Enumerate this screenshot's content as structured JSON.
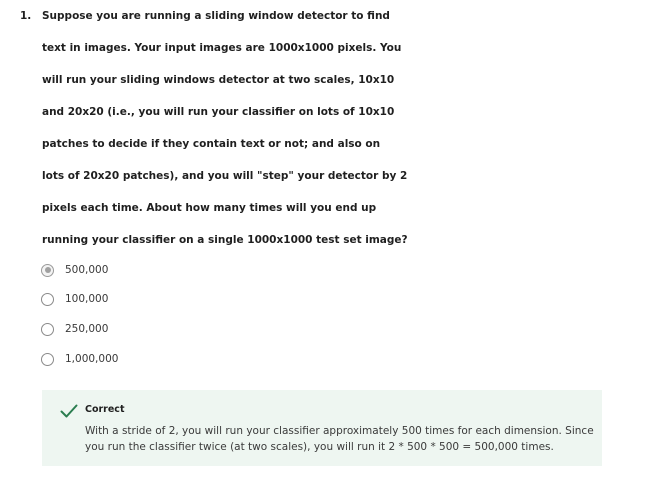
{
  "question": {
    "number": "1.",
    "lines": [
      "Suppose you are running a sliding window detector to find",
      "text in images. Your input images are 1000x1000 pixels. You",
      "will run your sliding windows detector at two scales, 10x10",
      "and 20x20 (i.e., you will run your classifier on lots of 10x10",
      "patches to decide if they contain text or not; and also on",
      "lots of 20x20 patches), and you will \"step\" your detector by 2",
      "pixels each time. About how many times will you end up",
      "running your classifier on a single 1000x1000 test set image?"
    ]
  },
  "options": [
    {
      "label": "500,000",
      "selected": true
    },
    {
      "label": "100,000",
      "selected": false
    },
    {
      "label": "250,000",
      "selected": false
    },
    {
      "label": "1,000,000",
      "selected": false
    }
  ],
  "feedback": {
    "icon": "checkmark-icon",
    "title": "Correct",
    "lines": [
      "With a stride of 2, you will run your classifier approximately 500 times for each dimension. Since",
      "you run the classifier twice (at two scales), you will run it 2 * 500 * 500 = 500,000 times."
    ],
    "accent_color": "#2a7d4f",
    "background_color": "#eef6f1"
  }
}
